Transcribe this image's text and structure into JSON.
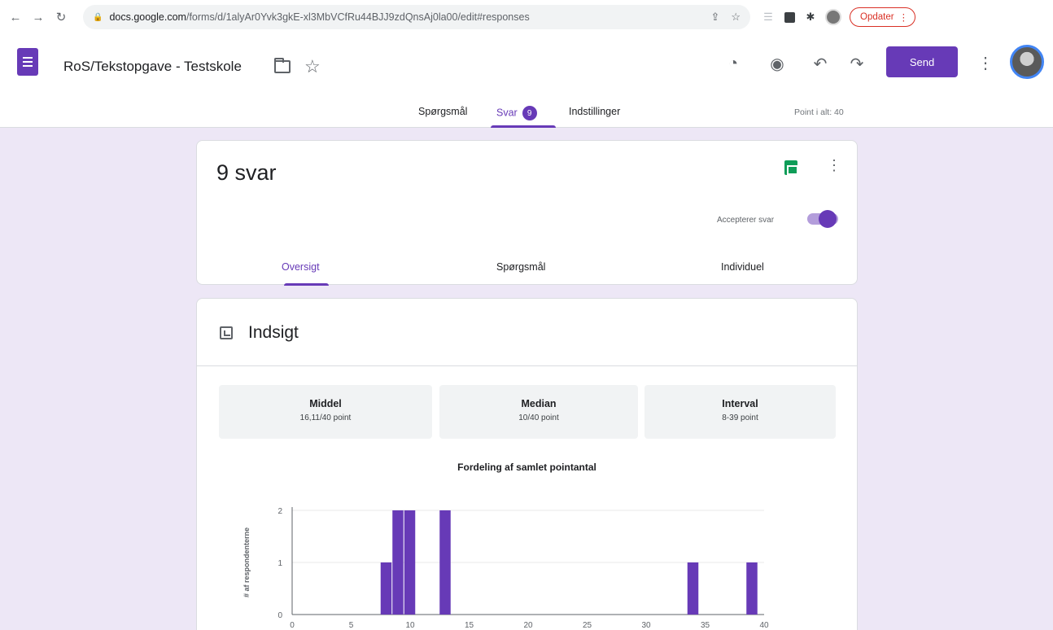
{
  "browser": {
    "url_host": "docs.google.com",
    "url_path": "/forms/d/1alyAr0Yvk3gkE-xl3MbVCfRu44BJJ9zdQnsAj0la00/edit#responses",
    "update_label": "Opdater",
    "icons": [
      "back-icon",
      "forward-icon",
      "reload-icon",
      "lock-icon",
      "share-icon",
      "bookmark-star-icon",
      "reading-list-icon",
      "extension-icon",
      "puzzle-icon",
      "profile-icon",
      "more-vert-icon"
    ]
  },
  "app": {
    "title": "RoS/Tekstopgave - Testskole",
    "send_label": "Send",
    "accent_color": "#673ab7",
    "tabs": [
      {
        "label": "Spørgsmål"
      },
      {
        "label": "Svar",
        "badge": "9"
      },
      {
        "label": "Indstillinger"
      }
    ],
    "points_total": "Point i alt: 40"
  },
  "summary": {
    "count": "9 svar",
    "accepting_label": "Accepterer svar",
    "accepting": true,
    "subtabs": [
      "Oversigt",
      "Spørgsmål",
      "Individuel"
    ]
  },
  "insights": {
    "title": "Indsigt",
    "stats": [
      {
        "label": "Middel",
        "value": "16,11/40 point"
      },
      {
        "label": "Median",
        "value": "10/40 point"
      },
      {
        "label": "Interval",
        "value": "8-39 point"
      }
    ]
  },
  "chart_data": {
    "type": "bar",
    "title": "Fordeling af samlet pointantal",
    "xlabel": "",
    "ylabel": "# af respondenterne",
    "x_ticks": [
      0,
      5,
      10,
      15,
      20,
      25,
      30,
      35,
      40
    ],
    "y_ticks": [
      0,
      1,
      2
    ],
    "xlim": [
      0,
      40
    ],
    "ylim": [
      0,
      2
    ],
    "bar_color": "#673ab7",
    "grid": true,
    "x": [
      8,
      9,
      10,
      13,
      34,
      39
    ],
    "values": [
      1,
      2,
      2,
      2,
      1,
      1
    ]
  }
}
